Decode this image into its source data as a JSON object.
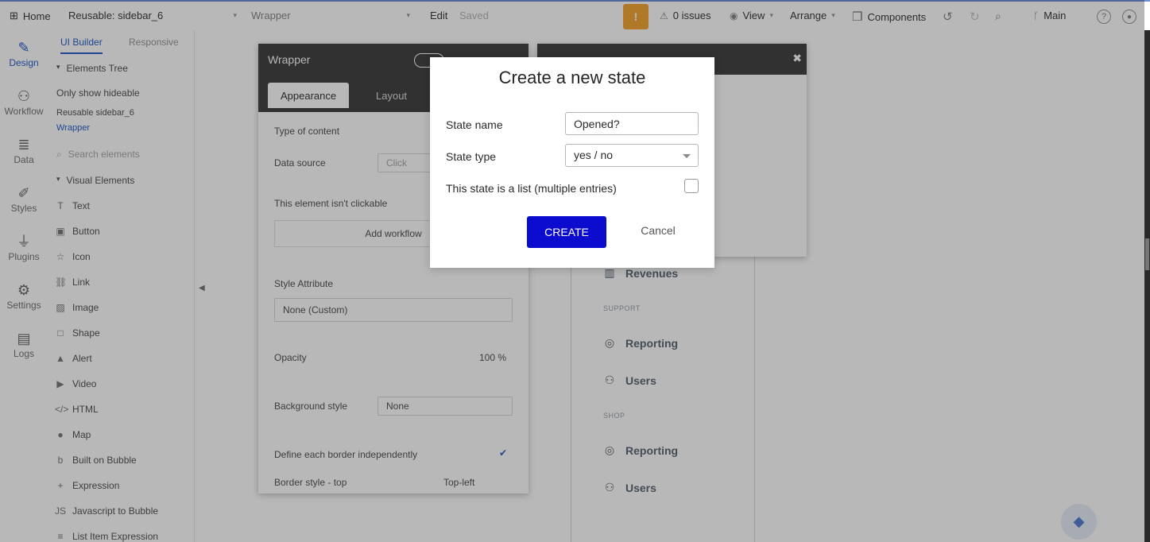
{
  "topbar": {
    "home": "Home",
    "page_name": "Reusable: sidebar_6",
    "element_name": "Wrapper",
    "edit": "Edit",
    "saved": "Saved",
    "issues": "0 issues",
    "view": "View",
    "arrange": "Arrange",
    "components": "Components",
    "branch": "Main"
  },
  "rail": {
    "items": [
      {
        "label": "Design",
        "icon": "design-icon"
      },
      {
        "label": "Workflow",
        "icon": "workflow-icon"
      },
      {
        "label": "Data",
        "icon": "data-icon"
      },
      {
        "label": "Styles",
        "icon": "styles-icon"
      },
      {
        "label": "Plugins",
        "icon": "plugins-icon"
      },
      {
        "label": "Settings",
        "icon": "settings-icon"
      },
      {
        "label": "Logs",
        "icon": "logs-icon"
      }
    ]
  },
  "panel": {
    "tabs": [
      "UI Builder",
      "Responsive"
    ],
    "tree_title": "Elements Tree",
    "filter": "Only show hideable",
    "tree_root": "Reusable sidebar_6",
    "tree_child": "Wrapper",
    "search_placeholder": "Search elements",
    "visual_title": "Visual Elements",
    "elements": [
      "Text",
      "Button",
      "Icon",
      "Link",
      "Image",
      "Shape",
      "Alert",
      "Video",
      "HTML",
      "Map",
      "Built on Bubble",
      "Expression",
      "Javascript to Bubble",
      "List Item Expression"
    ]
  },
  "property_editor": {
    "title": "Wrapper",
    "tabs": [
      "Appearance",
      "Layout"
    ],
    "type_of_content": "Type of content",
    "data_source": "Data source",
    "data_source_value": "Click",
    "not_clickable": "This element isn't clickable",
    "add_workflow": "Add workflow",
    "style_attribute": "Style Attribute",
    "style_value": "None (Custom)",
    "opacity": "Opacity",
    "opacity_value": "100 %",
    "background_style": "Background style",
    "background_value": "None",
    "define_border": "Define each border independently",
    "border_style_top": "Border style - top",
    "top_left": "Top-left"
  },
  "sidebar_preview": {
    "items": [
      {
        "type": "item",
        "label": "Revenues",
        "icon": "chart-icon"
      },
      {
        "type": "caption",
        "label": "SUPPORT"
      },
      {
        "type": "item",
        "label": "Reporting",
        "icon": "reporting-icon"
      },
      {
        "type": "item",
        "label": "Users",
        "icon": "users-icon"
      },
      {
        "type": "caption",
        "label": "SHOP"
      },
      {
        "type": "item",
        "label": "Reporting",
        "icon": "reporting-icon"
      },
      {
        "type": "item",
        "label": "Users",
        "icon": "users-icon"
      }
    ]
  },
  "modal": {
    "title": "Create a new state",
    "state_name_label": "State name",
    "state_name_value": "Opened?",
    "state_type_label": "State type",
    "state_type_value": "yes / no",
    "list_label": "This state is a list (multiple entries)",
    "create_button": "CREATE",
    "cancel_button": "Cancel"
  }
}
